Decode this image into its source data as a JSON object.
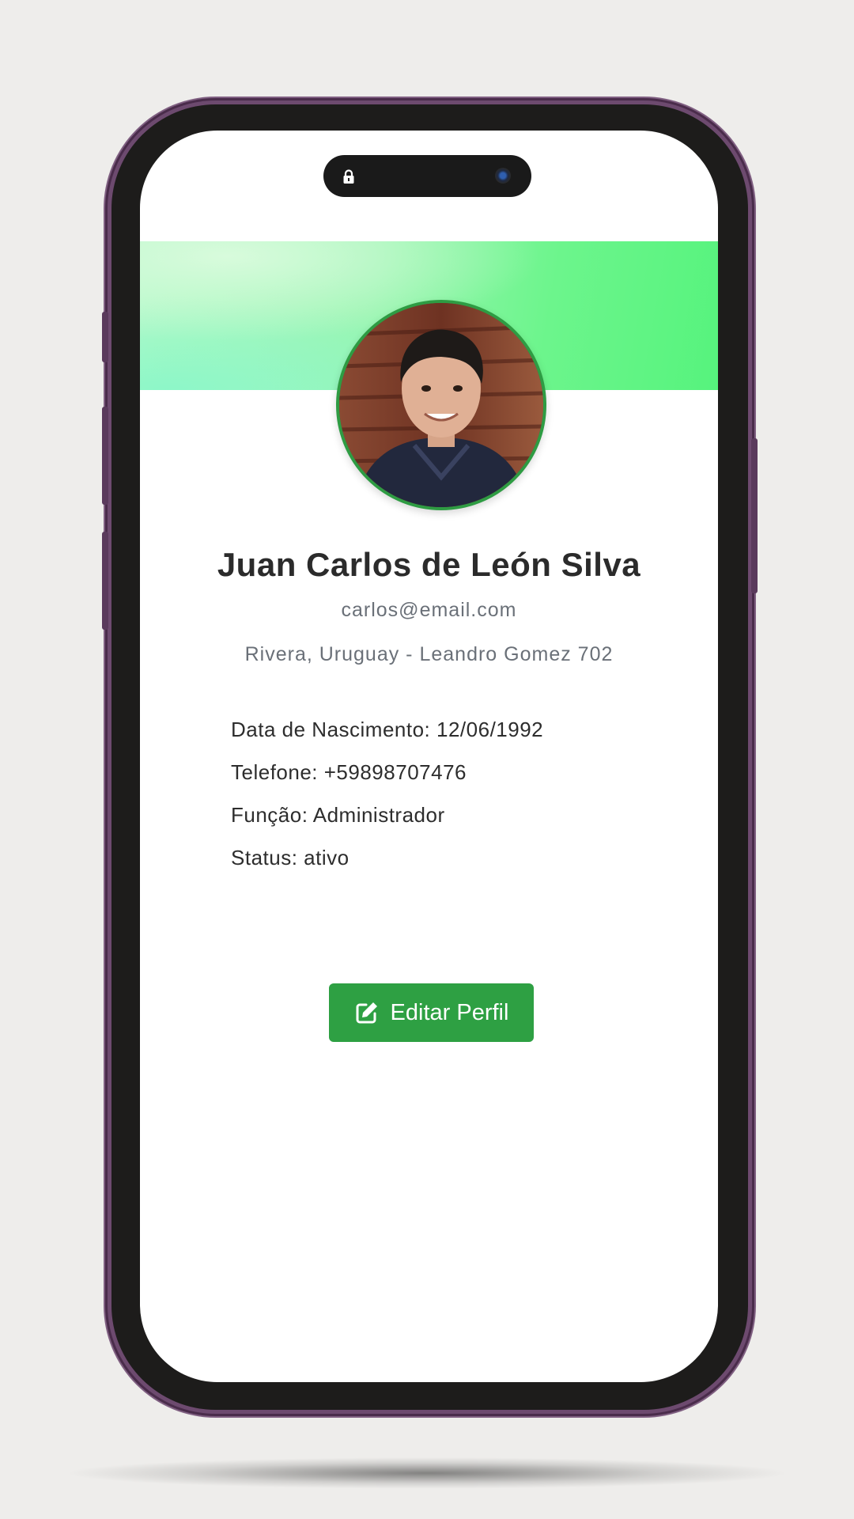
{
  "profile": {
    "name": "Juan Carlos de León Silva",
    "email": "carlos@email.com",
    "address": "Rivera, Uruguay - Leandro Gomez 702",
    "details": [
      "Data de Nascimento: 12/06/1992",
      "Telefone: +59898707476",
      "Função: Administrador",
      "Status: ativo"
    ]
  },
  "actions": {
    "edit_label": "Editar Perfil",
    "edit_icon": "pencil-square-icon"
  },
  "status_bar": {
    "left_icon": "lock-icon",
    "right_icon": "camera-icon"
  },
  "colors": {
    "accent": "#2ea043",
    "avatar_border": "#2e9c43",
    "phone_frame": "#6d4a6f",
    "cover_gradient": [
      "#b4f9c9",
      "#56f37d"
    ]
  }
}
